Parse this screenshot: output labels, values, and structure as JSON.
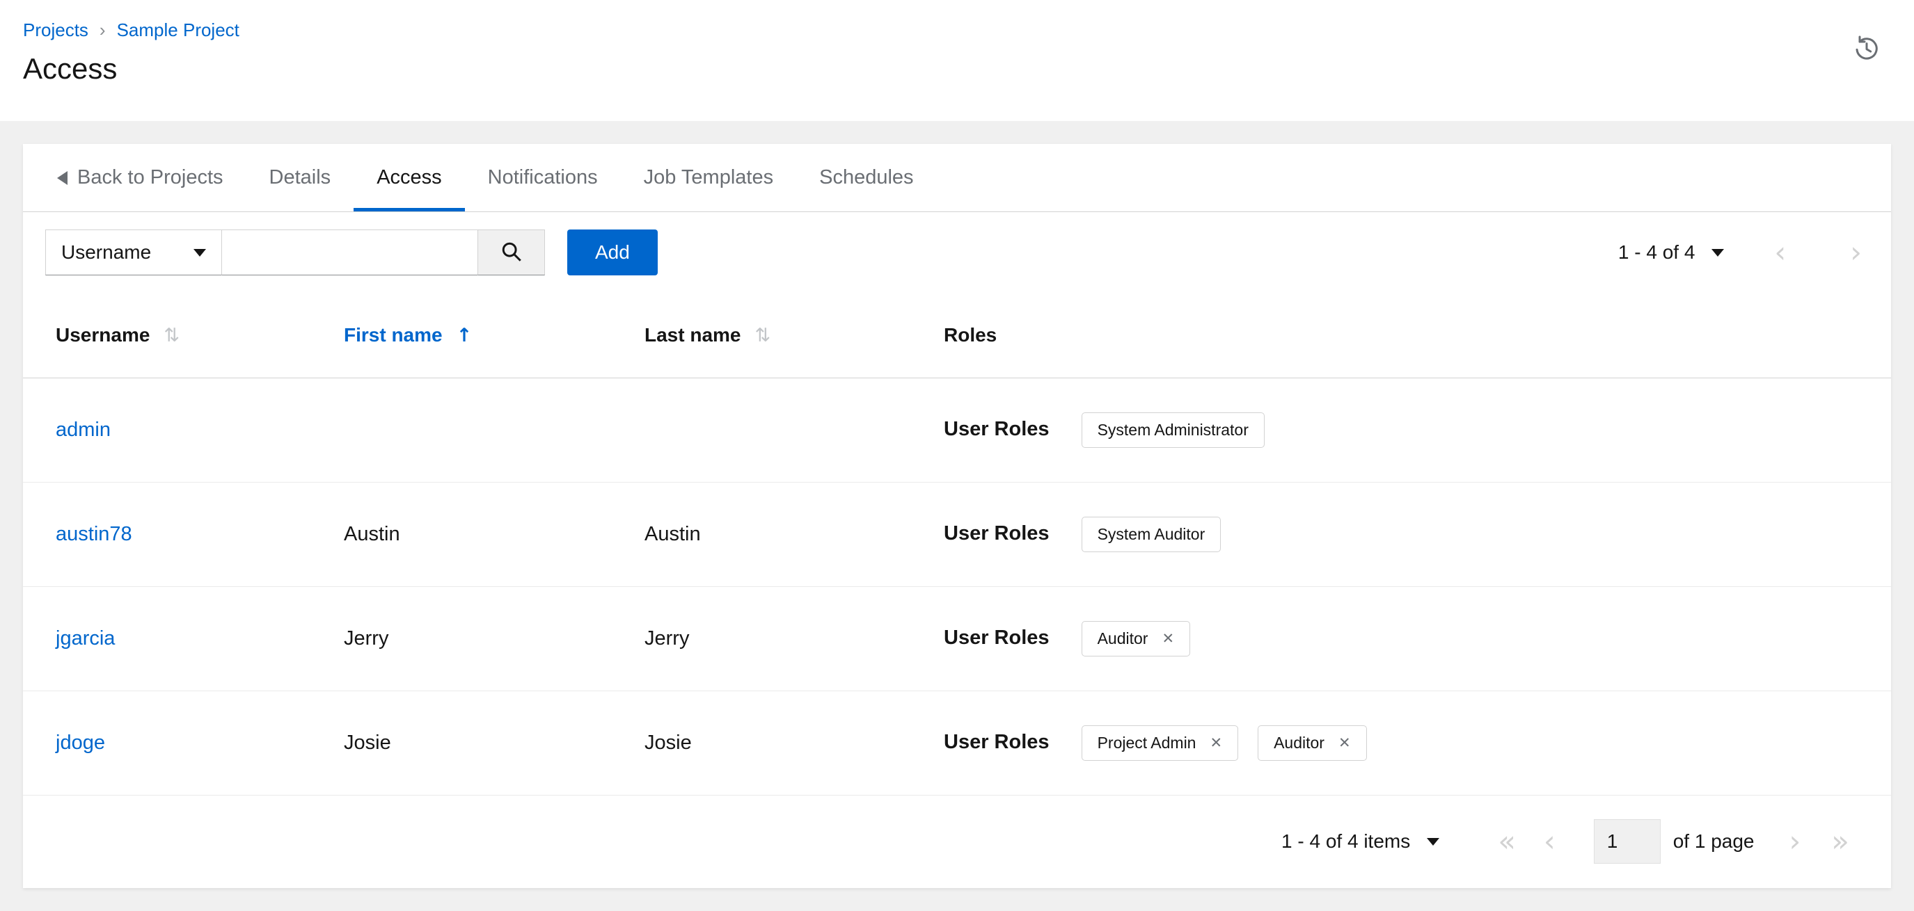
{
  "breadcrumb": {
    "items": [
      "Projects",
      "Sample Project"
    ],
    "separator": "›"
  },
  "page": {
    "title": "Access"
  },
  "tabs": {
    "back_label": "Back to Projects",
    "items": [
      {
        "label": "Details",
        "active": false
      },
      {
        "label": "Access",
        "active": true
      },
      {
        "label": "Notifications",
        "active": false
      },
      {
        "label": "Job Templates",
        "active": false
      },
      {
        "label": "Schedules",
        "active": false
      }
    ]
  },
  "toolbar": {
    "filter_dropdown": "Username",
    "search_value": "",
    "add_label": "Add",
    "pagination_summary": "1 - 4 of 4"
  },
  "table": {
    "headers": {
      "username": "Username",
      "first_name": "First name",
      "last_name": "Last name",
      "roles": "Roles"
    },
    "roles_label": "User Roles",
    "rows": [
      {
        "username": "admin",
        "first_name": "",
        "last_name": "",
        "roles": [
          {
            "name": "System Administrator",
            "removable": false
          }
        ]
      },
      {
        "username": "austin78",
        "first_name": "Austin",
        "last_name": "Austin",
        "roles": [
          {
            "name": "System Auditor",
            "removable": false
          }
        ]
      },
      {
        "username": "jgarcia",
        "first_name": "Jerry",
        "last_name": "Jerry",
        "roles": [
          {
            "name": "Auditor",
            "removable": true
          }
        ]
      },
      {
        "username": "jdoge",
        "first_name": "Josie",
        "last_name": "Josie",
        "roles": [
          {
            "name": "Project Admin",
            "removable": true
          },
          {
            "name": "Auditor",
            "removable": true
          }
        ]
      }
    ]
  },
  "footer": {
    "items_summary": "1 - 4 of 4 items",
    "page_value": "1",
    "of_pages_label": "of 1 page"
  },
  "icons": {
    "sort_both": "⇅",
    "sort_asc": "↑",
    "remove": "✕",
    "first_page": "«",
    "prev_page": "‹",
    "next_page": "›",
    "last_page": "»"
  },
  "colors": {
    "primary": "#0066cc",
    "link": "#0066cc",
    "text": "#151515",
    "muted": "#6a6e73"
  }
}
